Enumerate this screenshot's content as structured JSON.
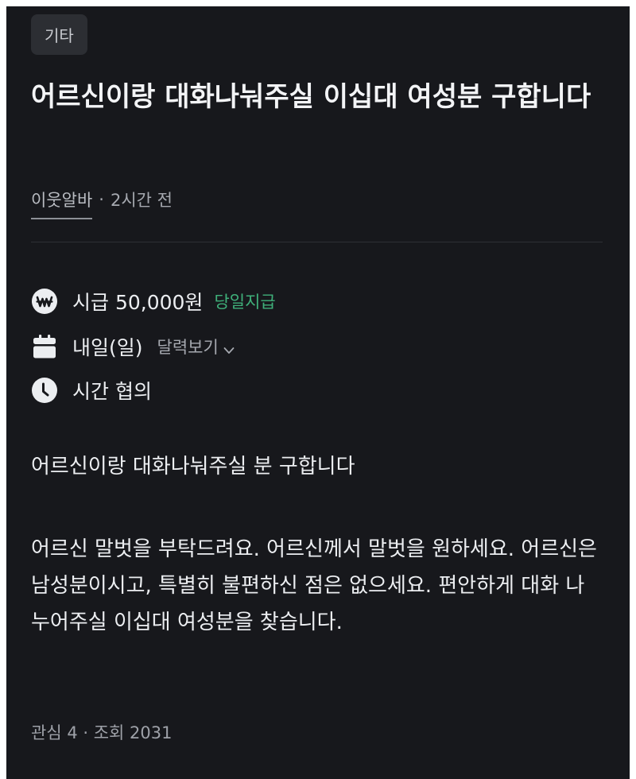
{
  "category": "기타",
  "post": {
    "title": "어르신이랑 대화나눠주실 이십대 여성분 구합니다",
    "author": "이웃알바",
    "separator": "·",
    "time_ago": "2시간 전"
  },
  "job": {
    "wage": "시급 50,000원",
    "wage_badge": "당일지급",
    "date": "내일(일)",
    "calendar_link": "달력보기",
    "work_time": "시간 협의"
  },
  "description": {
    "headline": "어르신이랑 대화나눠주실 분 구합니다",
    "body": "어르신 말벗을 부탁드려요. 어르신께서 말벗을 원하세요. 어르신은 남성분이시고, 특별히 불편하신 점은 없으세요. 편안하게 대화 나누어주실 이십대 여성분을 찾습니다."
  },
  "stats": {
    "text": "관심 4 · 조회 2031"
  },
  "icons": {
    "wage": "won-coin-icon",
    "date": "calendar-icon",
    "time": "clock-icon",
    "dropdown": "chevron-down-icon"
  },
  "colors": {
    "background": "#17181c",
    "accent_green": "#3fb07a",
    "chip_bg": "#2c2e33"
  }
}
